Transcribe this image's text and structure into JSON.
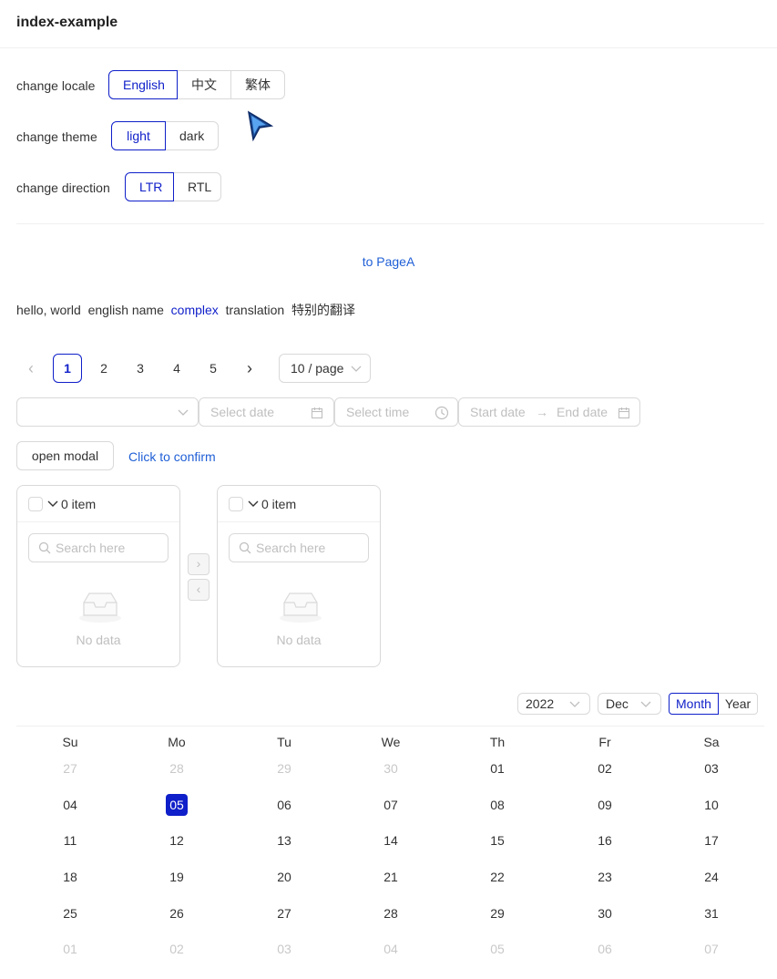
{
  "header": {
    "title": "index-example"
  },
  "settings": {
    "locale": {
      "label": "change locale",
      "options": [
        "English",
        "中文",
        "繁体"
      ],
      "active": 0
    },
    "theme": {
      "label": "change theme",
      "options": [
        "light",
        "dark"
      ],
      "active": 0
    },
    "direction": {
      "label": "change direction",
      "options": [
        "LTR",
        "RTL"
      ],
      "active": 0
    }
  },
  "nav": {
    "link": "to PageA"
  },
  "translations": {
    "t1": "hello, world",
    "t2": "english name",
    "t3": "complex",
    "t4": "translation",
    "t5": "特别的翻译"
  },
  "pagination": {
    "pages": [
      "1",
      "2",
      "3",
      "4",
      "5"
    ],
    "active": 0,
    "page_size": "10 / page",
    "prev": "‹",
    "next": "›"
  },
  "pickers": {
    "select_value": "",
    "date_placeholder": "Select date",
    "time_placeholder": "Select time",
    "range_start": "Start date",
    "range_end": "End date",
    "range_sep": "→"
  },
  "actions": {
    "open_modal": "open modal",
    "confirm": "Click to confirm"
  },
  "transfer": {
    "left": {
      "count": "0 item",
      "search_placeholder": "Search here",
      "empty": "No data"
    },
    "right": {
      "count": "0 item",
      "search_placeholder": "Search here",
      "empty": "No data"
    },
    "move_right": "›",
    "move_left": "‹"
  },
  "calendar": {
    "year": "2022",
    "month": "Dec",
    "modes": [
      "Month",
      "Year"
    ],
    "active_mode": 0,
    "weekdays": [
      "Su",
      "Mo",
      "Tu",
      "We",
      "Th",
      "Fr",
      "Sa"
    ],
    "weeks": [
      [
        {
          "d": "27",
          "m": true
        },
        {
          "d": "28",
          "m": true
        },
        {
          "d": "29",
          "m": true
        },
        {
          "d": "30",
          "m": true
        },
        {
          "d": "01"
        },
        {
          "d": "02"
        },
        {
          "d": "03"
        }
      ],
      [
        {
          "d": "04"
        },
        {
          "d": "05",
          "s": true
        },
        {
          "d": "06"
        },
        {
          "d": "07"
        },
        {
          "d": "08"
        },
        {
          "d": "09"
        },
        {
          "d": "10"
        }
      ],
      [
        {
          "d": "11"
        },
        {
          "d": "12"
        },
        {
          "d": "13"
        },
        {
          "d": "14"
        },
        {
          "d": "15"
        },
        {
          "d": "16"
        },
        {
          "d": "17"
        }
      ],
      [
        {
          "d": "18"
        },
        {
          "d": "19"
        },
        {
          "d": "20"
        },
        {
          "d": "21"
        },
        {
          "d": "22"
        },
        {
          "d": "23"
        },
        {
          "d": "24"
        }
      ],
      [
        {
          "d": "25"
        },
        {
          "d": "26"
        },
        {
          "d": "27"
        },
        {
          "d": "28"
        },
        {
          "d": "29"
        },
        {
          "d": "30"
        },
        {
          "d": "31"
        }
      ],
      [
        {
          "d": "01",
          "m": true
        },
        {
          "d": "02",
          "m": true
        },
        {
          "d": "03",
          "m": true
        },
        {
          "d": "04",
          "m": true
        },
        {
          "d": "05",
          "m": true
        },
        {
          "d": "06",
          "m": true
        },
        {
          "d": "07",
          "m": true
        }
      ]
    ]
  },
  "colors": {
    "primary": "#0f1fc9",
    "link": "#1f5fd6",
    "border": "#d9d9d9",
    "muted": "#bfbfbf"
  }
}
